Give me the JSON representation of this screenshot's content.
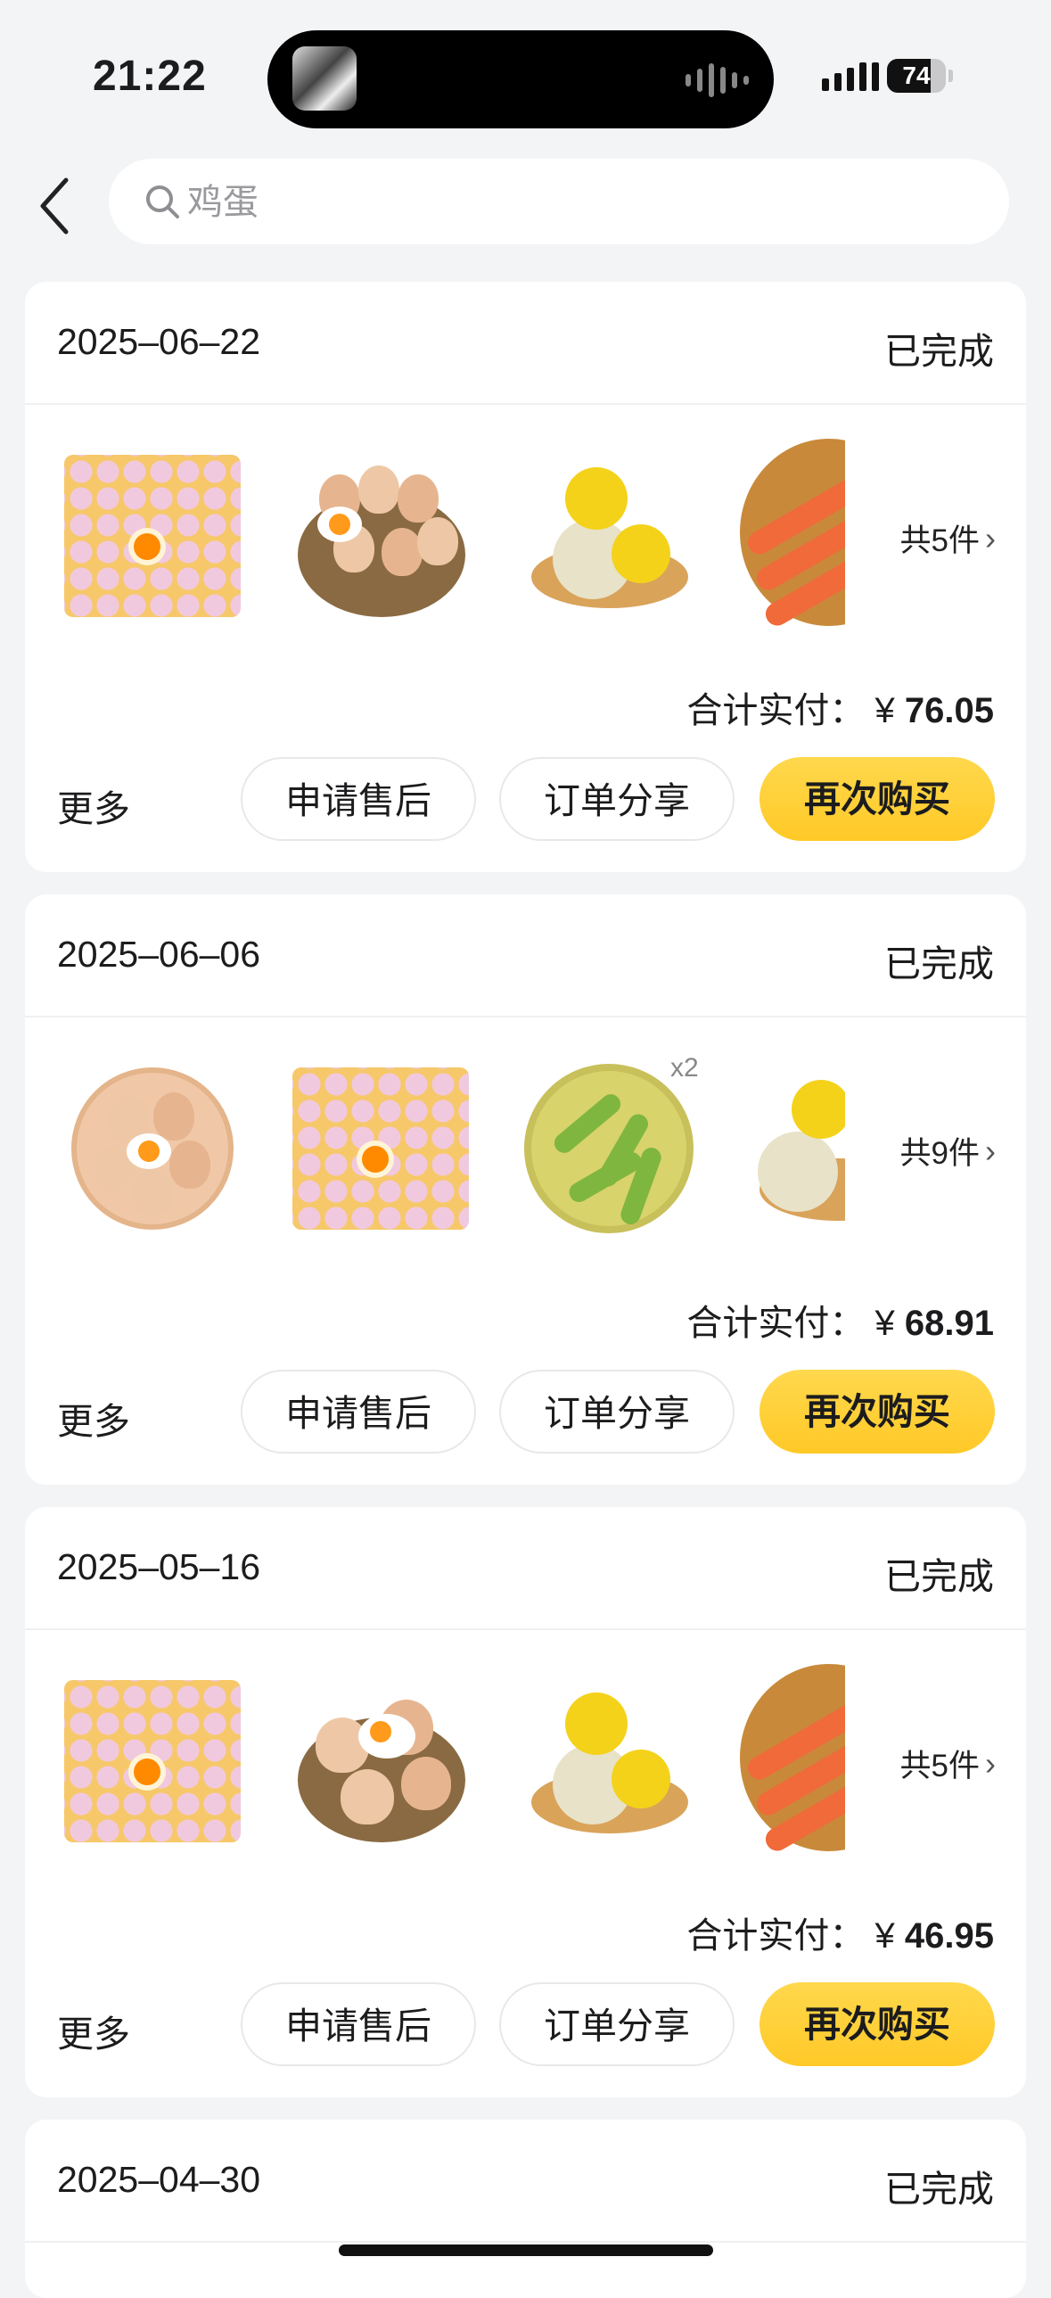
{
  "status_bar": {
    "time": "21:22",
    "battery": "74",
    "battery_level": 0.74
  },
  "search": {
    "placeholder": "鸡蛋"
  },
  "labels": {
    "more": "更多",
    "after_sales": "申请售后",
    "share": "订单分享",
    "rebuy": "再次购买",
    "total_prefix": "合计实付：",
    "currency": "¥"
  },
  "orders": [
    {
      "date": "2025–06–22",
      "status": "已完成",
      "count": "共5件",
      "total": "76.05",
      "products": [
        "egg-tray",
        "egg-basket",
        "salted-egg",
        "carrots"
      ]
    },
    {
      "date": "2025–06–06",
      "status": "已完成",
      "count": "共9件",
      "total": "68.91",
      "products": [
        "egg-plate",
        "egg-tray",
        "edamame",
        "salted-egg"
      ],
      "qty_badge": "x2"
    },
    {
      "date": "2025–05–16",
      "status": "已完成",
      "count": "共5件",
      "total": "46.95",
      "products": [
        "egg-tray",
        "egg-basket",
        "salted-egg",
        "carrots"
      ]
    },
    {
      "date": "2025–04–30",
      "status": "已完成"
    }
  ]
}
